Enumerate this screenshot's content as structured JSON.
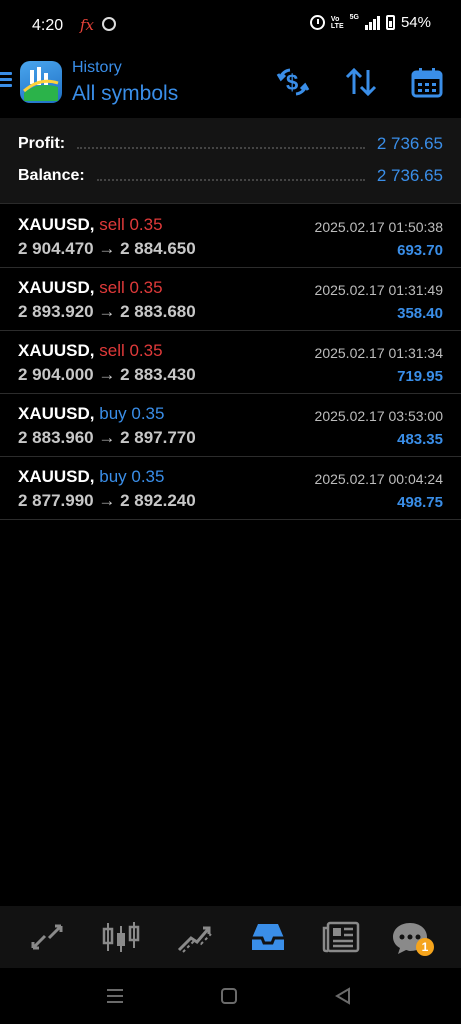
{
  "status_bar": {
    "time": "4:20",
    "fx": "fx",
    "net_label_top": "Vo",
    "net_label_bottom": "LTE",
    "net_gen": "5G",
    "battery": "54%"
  },
  "header": {
    "subtitle": "History",
    "title": "All symbols",
    "icons": [
      "menu-icon",
      "metatrader-logo",
      "currency-sync-icon",
      "sort-icon",
      "calendar-icon"
    ]
  },
  "summary": {
    "profit_label": "Profit:",
    "profit_value": "2 736.65",
    "balance_label": "Balance:",
    "balance_value": "2 736.65"
  },
  "deals": [
    {
      "symbol": "XAUUSD,",
      "type": "sell 0.35",
      "side": "sell",
      "prices": "2 904.470 → 2 884.650",
      "time": "2025.02.17 01:50:38",
      "profit": "693.70"
    },
    {
      "symbol": "XAUUSD,",
      "type": "sell 0.35",
      "side": "sell",
      "prices": "2 893.920 → 2 883.680",
      "time": "2025.02.17 01:31:49",
      "profit": "358.40"
    },
    {
      "symbol": "XAUUSD,",
      "type": "sell 0.35",
      "side": "sell",
      "prices": "2 904.000 → 2 883.430",
      "time": "2025.02.17 01:31:34",
      "profit": "719.95"
    },
    {
      "symbol": "XAUUSD,",
      "type": "buy 0.35",
      "side": "buy",
      "prices": "2 883.960 → 2 897.770",
      "time": "2025.02.17 03:53:00",
      "profit": "483.35"
    },
    {
      "symbol": "XAUUSD,",
      "type": "buy 0.35",
      "side": "buy",
      "prices": "2 877.990 → 2 892.240",
      "time": "2025.02.17 00:04:24",
      "profit": "498.75"
    }
  ],
  "bottom_nav": {
    "items": [
      "quotes-icon",
      "chart-icon",
      "trade-icon",
      "history-icon",
      "news-icon",
      "messages-icon"
    ],
    "active": "history-icon",
    "messages_badge": "1"
  },
  "colors": {
    "accent": "#3a8ee8",
    "sell": "#e03a3a",
    "badge": "#f5a41c",
    "background": "#000000"
  }
}
